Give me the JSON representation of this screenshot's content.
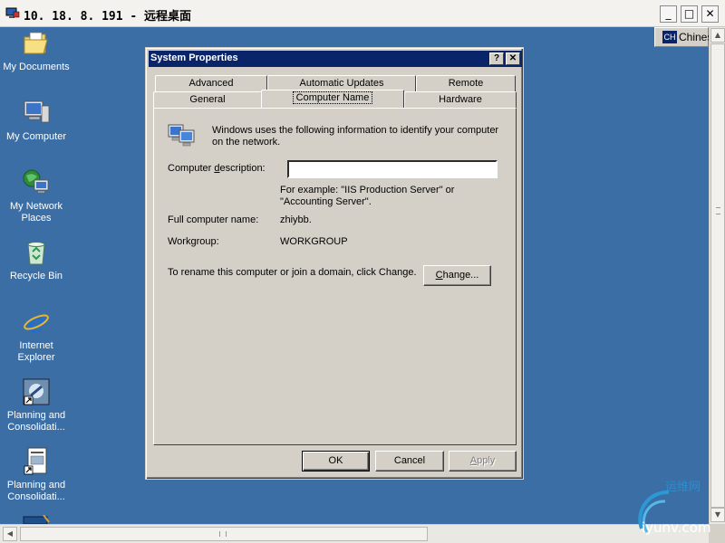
{
  "rdp": {
    "title": "10. 18. 8. 191  -  远程桌面",
    "buttons": {
      "minimize": "_",
      "maximize": "□",
      "close": "✕"
    }
  },
  "language_bar": {
    "code": "CH",
    "name": "Chinese"
  },
  "desktop_icons": [
    {
      "id": "my-documents",
      "line1": "My Documents",
      "line2": ""
    },
    {
      "id": "my-computer",
      "line1": "My Computer",
      "line2": ""
    },
    {
      "id": "my-network-places",
      "line1": "My Network",
      "line2": "Places"
    },
    {
      "id": "recycle-bin",
      "line1": "Recycle Bin",
      "line2": ""
    },
    {
      "id": "internet-explorer",
      "line1": "Internet",
      "line2": "Explorer"
    },
    {
      "id": "planning-consolidation-1",
      "line1": "Planning and",
      "line2": "Consolidati..."
    },
    {
      "id": "planning-consolidation-2",
      "line1": "Planning and",
      "line2": "Consolidati..."
    }
  ],
  "dialog": {
    "title": "System Properties",
    "help_button": "?",
    "close_button": "✕",
    "tabs_row1": [
      "Advanced",
      "Automatic Updates",
      "Remote"
    ],
    "tabs_row2": [
      "General",
      "Computer Name",
      "Hardware"
    ],
    "active_tab": "Computer Name",
    "intro_line1": "Windows uses the following information to identify your computer",
    "intro_line2": "on the network.",
    "description_label_pre": "Computer ",
    "description_label_accel": "d",
    "description_label_post": "escription:",
    "description_value": "",
    "example_line1": "For example: \"IIS Production Server\" or",
    "example_line2": "\"Accounting Server\".",
    "full_name_label": "Full computer name:",
    "full_name_value": "zhiybb.",
    "workgroup_label": "Workgroup:",
    "workgroup_value": "WORKGROUP",
    "rename_text": "To rename this computer or join a domain, click Change.",
    "change_button_accel": "C",
    "change_button_rest": "hange...",
    "ok_button": "OK",
    "cancel_button": "Cancel",
    "apply_button_accel": "A",
    "apply_button_rest": "pply"
  },
  "watermark": {
    "text": "运维网",
    "url_text": "iyunv.com"
  }
}
